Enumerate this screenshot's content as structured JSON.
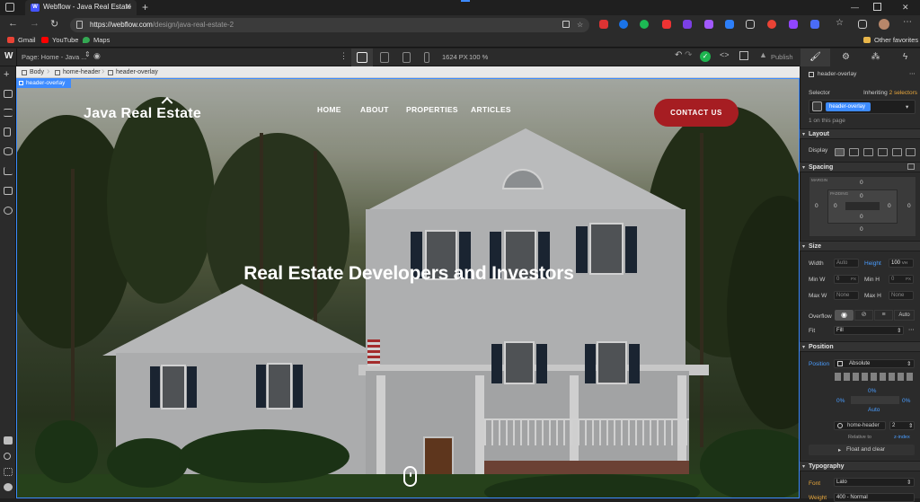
{
  "browser": {
    "tab_title": "Webflow - Java Real Estate",
    "tab_favicon": "W",
    "url_host": "https://webflow.com",
    "url_path": "/design/java-real-estate-2",
    "bookmarks": [
      "Gmail",
      "YouTube",
      "Maps"
    ],
    "other_favorites": "Other favorites"
  },
  "webflow_bar": {
    "page_label": "Page: Home - Java ...",
    "canvas_size": "1624 PX",
    "zoom": "100 %",
    "publish": "Publish"
  },
  "breadcrumbs": [
    "Body",
    "home-header",
    "header-overlay"
  ],
  "selection_tag": "header-overlay",
  "site": {
    "logo": "Java Real Estate",
    "nav": [
      "HOME",
      "ABOUT",
      "PROPERTIES",
      "ARTICLES"
    ],
    "cta": "CONTACT US",
    "headline": "Real Estate Developers and Investors"
  },
  "panel": {
    "element_name": "header-overlay",
    "selector_label": "Selector",
    "inheriting": "Inheriting",
    "inheriting_count": "2 selectors",
    "selector_chip": "header-overlay",
    "on_page": "1 on this page",
    "layout": "Layout",
    "display": "Display",
    "spacing": "Spacing",
    "margin": "MARGIN",
    "padding": "PADDING",
    "zero": "0",
    "size": "Size",
    "width": "Width",
    "width_val": "Auto",
    "height": "Height",
    "height_val": "100",
    "height_unit": "VH",
    "min_w": "Min W",
    "min_h": "Min H",
    "max_w": "Max W",
    "max_h": "Max H",
    "px": "PX",
    "none": "None",
    "min_zero": "0",
    "overflow": "Overflow",
    "overflow_auto": "Auto",
    "fit": "Fit",
    "fit_val": "Fill",
    "position_sec": "Position",
    "position": "Position",
    "position_val": "Absolute",
    "pct": "0%",
    "auto": "Auto",
    "relative_el": "home-header",
    "zindex_val": "2",
    "relative_to": "Relative to",
    "zindex": "z-index",
    "float_clear": "Float and clear",
    "typography": "Typography",
    "font": "Font",
    "font_val": "Lato",
    "weight": "Weight",
    "weight_val": "400 - Normal"
  },
  "colors": {
    "webflow_blue": "#4353ff",
    "selection_blue": "#3d8bff",
    "cta_red": "#a61d22"
  }
}
